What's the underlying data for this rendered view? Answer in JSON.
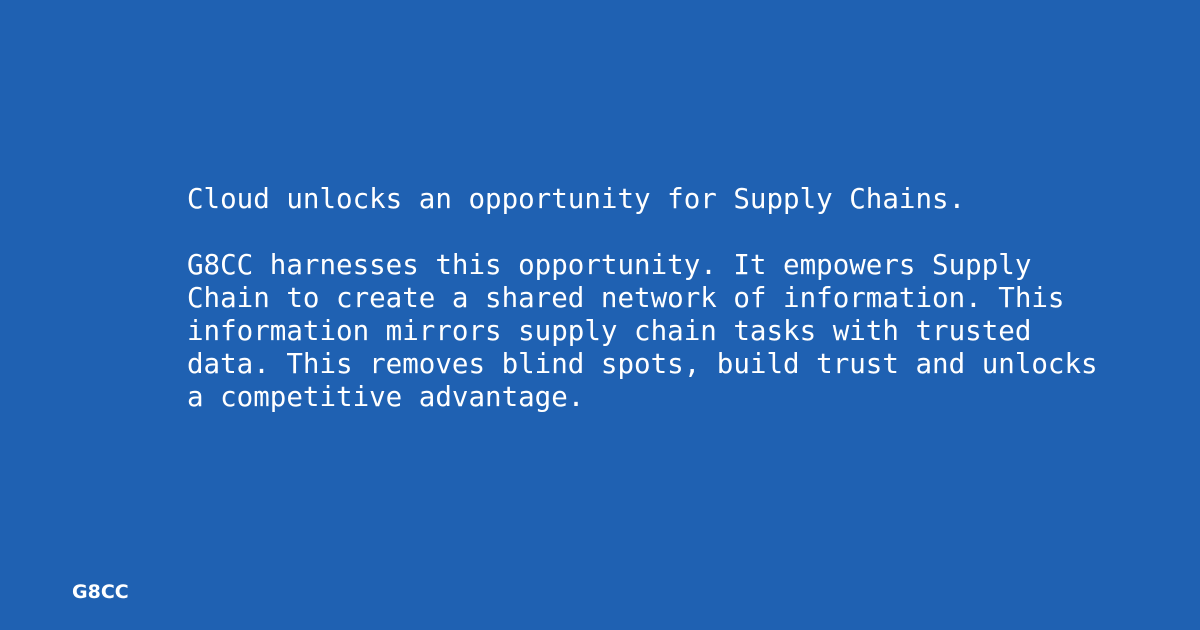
{
  "headline": "Cloud unlocks an opportunity for Supply Chains.",
  "body_lines": [
    "G8CC harnesses this opportunity. It empowers Supply",
    "Chain to create a shared network of information. This",
    "information mirrors supply chain tasks with trusted",
    "data. This removes blind spots, build trust and unlocks",
    "a competitive advantage."
  ],
  "brand": "G8CC",
  "colors": {
    "background": "#1f61b2",
    "text": "#ffffff"
  }
}
